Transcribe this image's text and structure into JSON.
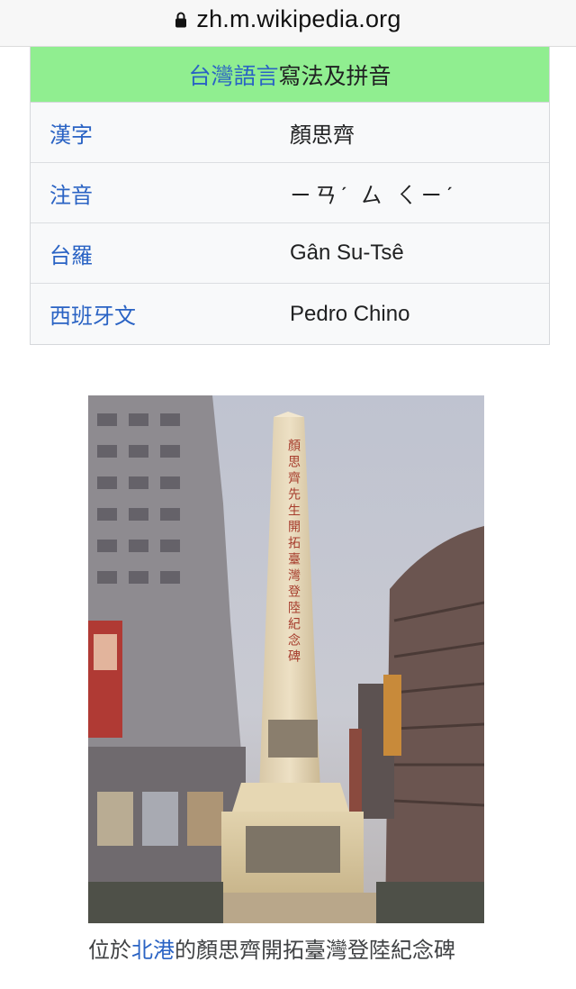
{
  "browser": {
    "url": "zh.m.wikipedia.org"
  },
  "infobox": {
    "header_link": "台灣語言",
    "header_text": "寫法及拼音",
    "header_bg": "#90ee90",
    "rows": [
      {
        "label": "漢字",
        "value": "顏思齊"
      },
      {
        "label": "注音",
        "value": "ㄧㄢˊ ㄙ ㄑㄧˊ"
      },
      {
        "label": "台羅",
        "value": "Gân Su-Tsê"
      },
      {
        "label": "西班牙文",
        "value": "Pedro Chino"
      }
    ]
  },
  "figure": {
    "inscription": "顏思齊先生開拓臺灣登陸紀念碑",
    "caption_before": "位於",
    "caption_link": "北港",
    "caption_after": "的顏思齊開拓臺灣登陸紀念碑"
  },
  "colors": {
    "link": "#2a63c4",
    "text": "#202122"
  }
}
